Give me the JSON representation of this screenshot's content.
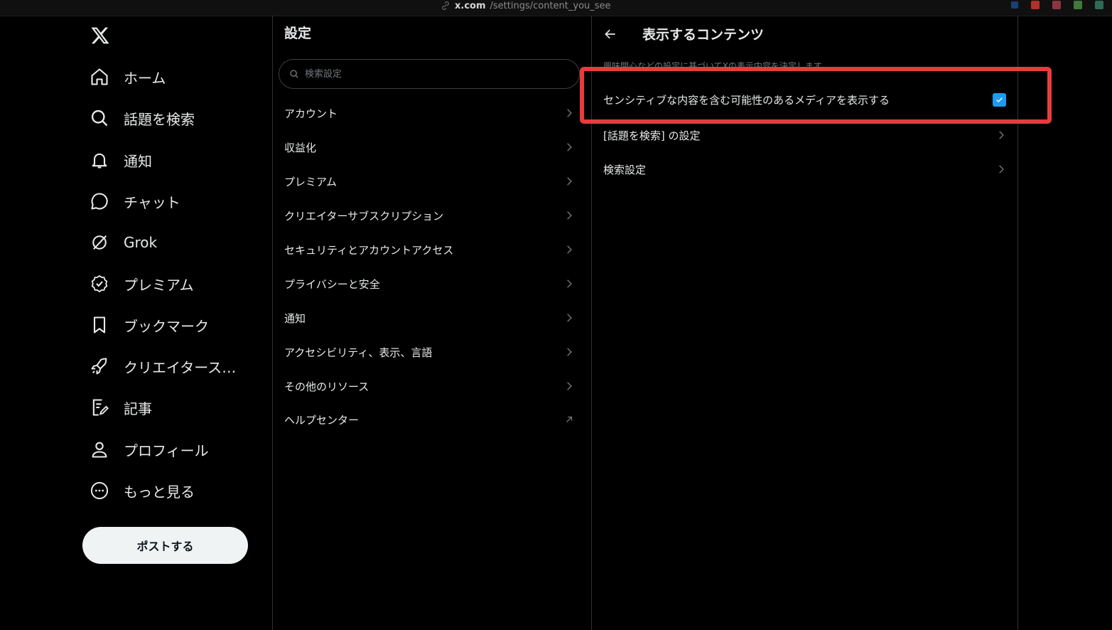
{
  "browser": {
    "url_host": "x.com",
    "url_path": "/settings/content_you_see"
  },
  "nav": {
    "items": [
      {
        "label": "ホーム",
        "icon": "home-icon"
      },
      {
        "label": "話題を検索",
        "icon": "search-icon"
      },
      {
        "label": "通知",
        "icon": "bell-icon"
      },
      {
        "label": "チャット",
        "icon": "chat-icon"
      },
      {
        "label": "Grok",
        "icon": "grok-icon"
      },
      {
        "label": "プレミアム",
        "icon": "verified-icon"
      },
      {
        "label": "ブックマーク",
        "icon": "bookmark-icon"
      },
      {
        "label": "クリエイタース…",
        "icon": "rocket-icon"
      },
      {
        "label": "記事",
        "icon": "article-icon"
      },
      {
        "label": "プロフィール",
        "icon": "person-icon"
      },
      {
        "label": "もっと見る",
        "icon": "more-icon"
      }
    ],
    "post_button": "ポストする"
  },
  "settings": {
    "title": "設定",
    "search_placeholder": "検索設定",
    "items": [
      {
        "label": "アカウント"
      },
      {
        "label": "収益化"
      },
      {
        "label": "プレミアム"
      },
      {
        "label": "クリエイターサブスクリプション"
      },
      {
        "label": "セキュリティとアカウントアクセス"
      },
      {
        "label": "プライバシーと安全"
      },
      {
        "label": "通知"
      },
      {
        "label": "アクセシビリティ、表示、言語"
      },
      {
        "label": "その他のリソース"
      },
      {
        "label": "ヘルプセンター"
      }
    ]
  },
  "content": {
    "title": "表示するコンテンツ",
    "description": "興味関心などの設定に基づいてXの表示内容を決定します。",
    "options": [
      {
        "label": "センシティブな内容を含む可能性のあるメディアを表示する",
        "checked": true
      },
      {
        "label": "[話題を検索] の設定"
      },
      {
        "label": "検索設定"
      }
    ]
  },
  "colors": {
    "accent": "#1d9bf0",
    "highlight": "#e83c3c",
    "background": "#000000"
  }
}
